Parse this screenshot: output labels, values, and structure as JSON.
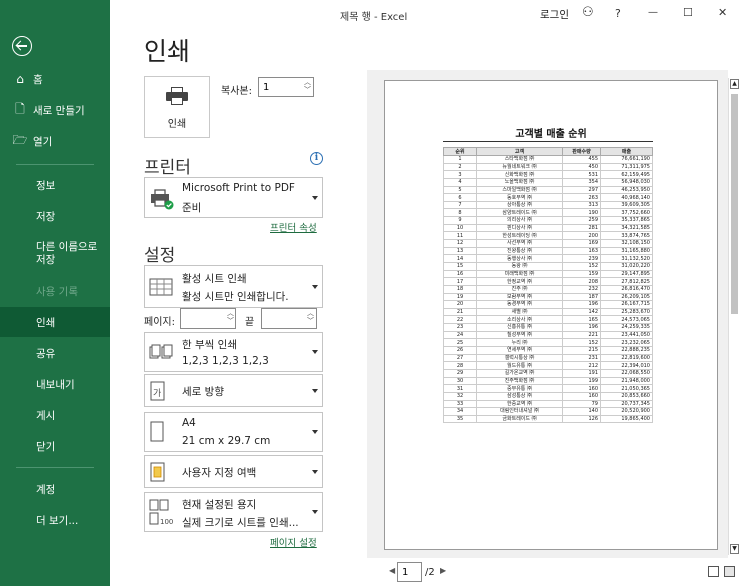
{
  "window": {
    "title": "제목 행 - Excel",
    "signin": "로그인",
    "help": "?",
    "minimize": "—",
    "maximize": "☐",
    "close": "✕"
  },
  "nav": {
    "back": "←",
    "home": "홈",
    "new": "새로 만들기",
    "open": "열기",
    "info": "정보",
    "save": "저장",
    "save_as": "다른 이름으로 저장",
    "history": "사용 기록",
    "print": "인쇄",
    "share": "공유",
    "export": "내보내기",
    "publish": "게시",
    "close": "닫기",
    "account": "계정",
    "more": "더 보기..."
  },
  "page_title": "인쇄",
  "print_button": "인쇄",
  "copies": {
    "label": "복사본:",
    "value": "1"
  },
  "printer": {
    "heading": "프린터",
    "name": "Microsoft Print to PDF",
    "status": "준비",
    "properties_link": "프린터 속성"
  },
  "settings": {
    "heading": "설정",
    "scope": {
      "line1": "활성 시트 인쇄",
      "line2": "활성 시트만 인쇄합니다."
    },
    "pages_label": "페이지:",
    "to_label": "끝",
    "collate": {
      "line1": "한 부씩 인쇄",
      "line2": "1,2,3    1,2,3    1,2,3"
    },
    "orientation": "세로 방향",
    "paper": {
      "line1": "A4",
      "line2": "21 cm x 29.7 cm"
    },
    "margins": "사용자 지정 여백",
    "scaling": {
      "line1": "현재 설정된 용지",
      "line2": "실제 크기로 시트를 인쇄..."
    },
    "page_setup_link": "페이지 설정"
  },
  "preview": {
    "sheet_title": "고객별 매출 순위",
    "headers": [
      "순위",
      "고객",
      "판매수량",
      "매출"
    ],
    "rows": [
      [
        "1",
        "스타백화점 ㈜",
        "455",
        "76,661,190"
      ],
      [
        "2",
        "뉴월네트워크 ㈜",
        "450",
        "71,311,975"
      ],
      [
        "3",
        "신화백화점 ㈜",
        "531",
        "62,159,495"
      ],
      [
        "4",
        "노을백화점 ㈜",
        "354",
        "56,948,030"
      ],
      [
        "5",
        "스마일백화점 ㈜",
        "297",
        "46,253,950"
      ],
      [
        "6",
        "동호무역 ㈜",
        "263",
        "40,968,140"
      ],
      [
        "7",
        "상아통상 ㈜",
        "313",
        "39,609,305"
      ],
      [
        "8",
        "삼양트레이드 ㈜",
        "190",
        "37,752,660"
      ],
      [
        "9",
        "의리상사 ㈜",
        "259",
        "35,337,865"
      ],
      [
        "10",
        "핀디상사 ㈜",
        "281",
        "34,321,585"
      ],
      [
        "11",
        "한성트레이딩 ㈜",
        "200",
        "33,874,765"
      ],
      [
        "12",
        "사선무역 ㈜",
        "169",
        "32,108,150"
      ],
      [
        "13",
        "진왕통상 ㈜",
        "163",
        "31,165,880"
      ],
      [
        "14",
        "동행상사 ㈜",
        "239",
        "31,132,520"
      ],
      [
        "15",
        "동왕 ㈜",
        "152",
        "31,020,220"
      ],
      [
        "16",
        "미래백화점 ㈜",
        "159",
        "29,147,895"
      ],
      [
        "17",
        "한정교역 ㈜",
        "208",
        "27,812,825"
      ],
      [
        "18",
        "진주 ㈜",
        "232",
        "26,816,470"
      ],
      [
        "19",
        "보람무역 ㈜",
        "187",
        "26,209,105"
      ],
      [
        "20",
        "동경무역 ㈜",
        "196",
        "26,167,715"
      ],
      [
        "21",
        "새별 ㈜",
        "142",
        "25,283,670"
      ],
      [
        "22",
        "소리상사 ㈜",
        "165",
        "24,573,065"
      ],
      [
        "23",
        "신흥유통 ㈜",
        "196",
        "24,259,335"
      ],
      [
        "24",
        "칠성무역 ㈜",
        "221",
        "23,441,050"
      ],
      [
        "25",
        "누리 ㈜",
        "152",
        "23,232,065"
      ],
      [
        "26",
        "연세무역 ㈜",
        "215",
        "22,888,235"
      ],
      [
        "27",
        "갤럭시통상 ㈜",
        "231",
        "22,819,600"
      ],
      [
        "28",
        "월드유통 ㈜",
        "212",
        "22,394,010"
      ],
      [
        "29",
        "길가온교역 ㈜",
        "191",
        "22,068,550"
      ],
      [
        "30",
        "진주백화점 ㈜",
        "199",
        "21,948,000"
      ],
      [
        "31",
        "중부유통 ㈜",
        "160",
        "21,050,365"
      ],
      [
        "32",
        "삼성통상 ㈜",
        "160",
        "20,853,660"
      ],
      [
        "33",
        "한중교역 ㈜",
        "79",
        "20,737,345"
      ],
      [
        "34",
        "대림인터내셔널 ㈜",
        "140",
        "20,520,900"
      ],
      [
        "35",
        "금화트레이드 ㈜",
        "126",
        "19,865,400"
      ]
    ]
  },
  "pager": {
    "current": "1",
    "total": "/2",
    "prev": "◀",
    "next": "▶"
  }
}
